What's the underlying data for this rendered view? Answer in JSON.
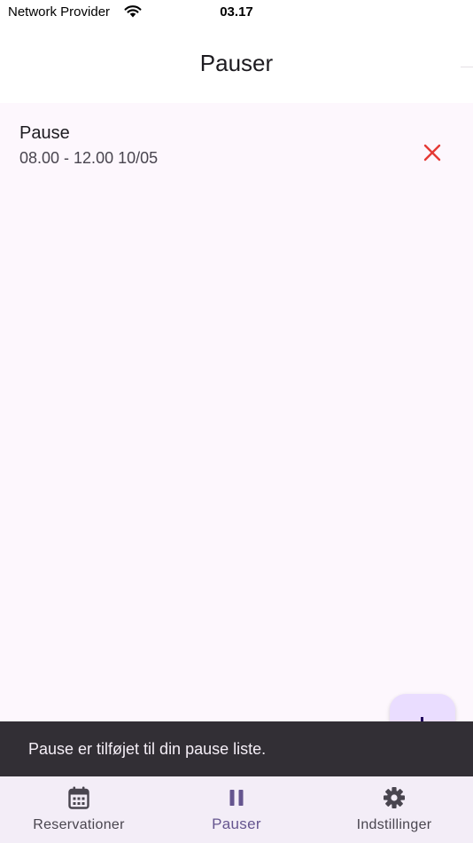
{
  "status_bar": {
    "carrier": "Network Provider",
    "wifi_icon": "wifi-icon",
    "time": "03.17"
  },
  "app_bar": {
    "title": "Pauser"
  },
  "pauses": [
    {
      "title": "Pause",
      "time_range": "08.00 - 12.00 10/05",
      "delete_icon": "close-icon"
    }
  ],
  "fab": {
    "icon": "plus-icon"
  },
  "snackbar": {
    "message": "Pause er tilføjet til din pause liste."
  },
  "bottom_nav": {
    "items": [
      {
        "label": "Reservationer",
        "icon": "calendar-icon"
      },
      {
        "label": "Pauser",
        "icon": "pause-icon",
        "active": true
      },
      {
        "label": "Indstillinger",
        "icon": "gear-icon"
      }
    ]
  },
  "colors": {
    "accent": "#65558f",
    "delete": "#e53935",
    "fab_background": "#eaddff",
    "snackbar_background": "#322f35",
    "page_background": "#fdf7fd"
  }
}
